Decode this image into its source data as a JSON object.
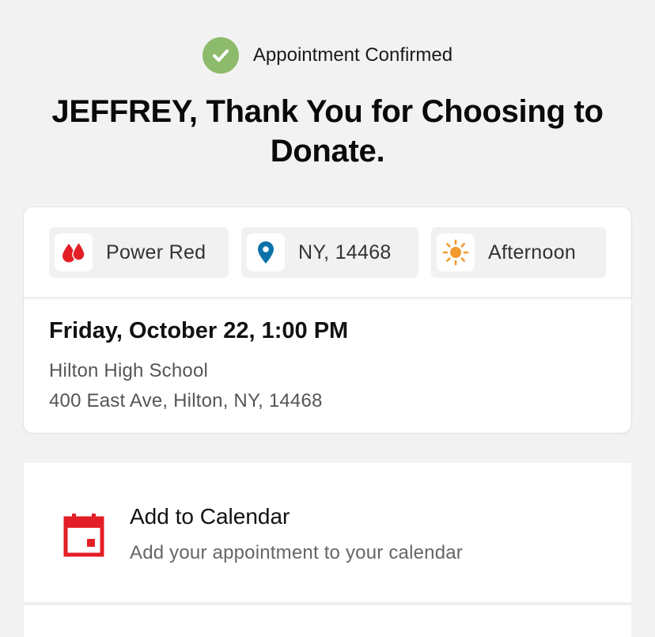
{
  "header": {
    "status_text": "Appointment Confirmed",
    "headline": "JEFFREY, Thank You for Choosing to Donate."
  },
  "appointment": {
    "chips": [
      {
        "label": "Power Red",
        "icon": "blood-drops-icon"
      },
      {
        "label": "NY, 14468",
        "icon": "location-pin-icon"
      },
      {
        "label": "Afternoon",
        "icon": "sun-icon"
      }
    ],
    "datetime": "Friday, October 22, 1:00 PM",
    "venue": "Hilton High School",
    "address": "400 East Ave, Hilton, NY, 14468"
  },
  "actions": {
    "calendar": {
      "title": "Add to Calendar",
      "subtitle": "Add your appointment to your calendar",
      "icon": "calendar-icon"
    }
  },
  "colors": {
    "success": "#8dbb6c",
    "brand_red": "#e41e26",
    "pin_blue": "#0a72a8",
    "sun_orange": "#f29a2e",
    "background": "#f2f2f2"
  }
}
